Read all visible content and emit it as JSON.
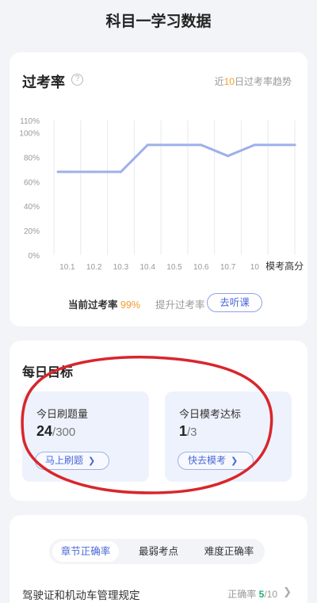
{
  "page": {
    "title": "科目一学习数据"
  },
  "pass_rate": {
    "title": "过考率",
    "help_icon": "question-circle-icon",
    "trend_prefix": "近",
    "trend_days": "10",
    "trend_suffix": "日过考率趋势",
    "current_label": "当前过考率",
    "current_value": "99%",
    "boost_label": "提升过考率",
    "listen_button": "去听课",
    "colors": {
      "line": "#9db0ea",
      "grid": "#e6e9f2",
      "accent": "#f39a2b",
      "brand": "#4a68d8"
    }
  },
  "chart_data": {
    "type": "line",
    "title": "",
    "xlabel": "",
    "ylabel": "",
    "categories": [
      "10.1",
      "10.2",
      "10.3",
      "10.4",
      "10.5",
      "10.6",
      "10.7",
      "10",
      "模考高分"
    ],
    "values": [
      68,
      68,
      68,
      90,
      90,
      90,
      81,
      90,
      90
    ],
    "y_ticks": [
      "0%",
      "20%",
      "40%",
      "60%",
      "80%",
      "100%",
      "110%"
    ],
    "ylim": [
      0,
      110
    ],
    "grid": true,
    "legend": "none"
  },
  "daily_goal": {
    "title": "每日目标",
    "items": [
      {
        "label": "今日刷题量",
        "current": "24",
        "total": "/300",
        "button": "马上刷题",
        "button_icon": "chevron-right-icon"
      },
      {
        "label": "今日模考达标",
        "current": "1",
        "total": "/3",
        "button": "快去模考",
        "button_icon": "chevron-right-icon"
      }
    ],
    "annotation_color": "#d8262c"
  },
  "accuracy": {
    "tabs": [
      {
        "label": "章节正确率",
        "active": true
      },
      {
        "label": "最弱考点",
        "active": false
      },
      {
        "label": "难度正确率",
        "active": false
      }
    ],
    "rows": [
      {
        "title": "驾驶证和机动车管理规定",
        "rate_label": "正确率",
        "rate_value": "5",
        "rate_total": "/10",
        "icon": "chevron-right-icon"
      }
    ]
  }
}
